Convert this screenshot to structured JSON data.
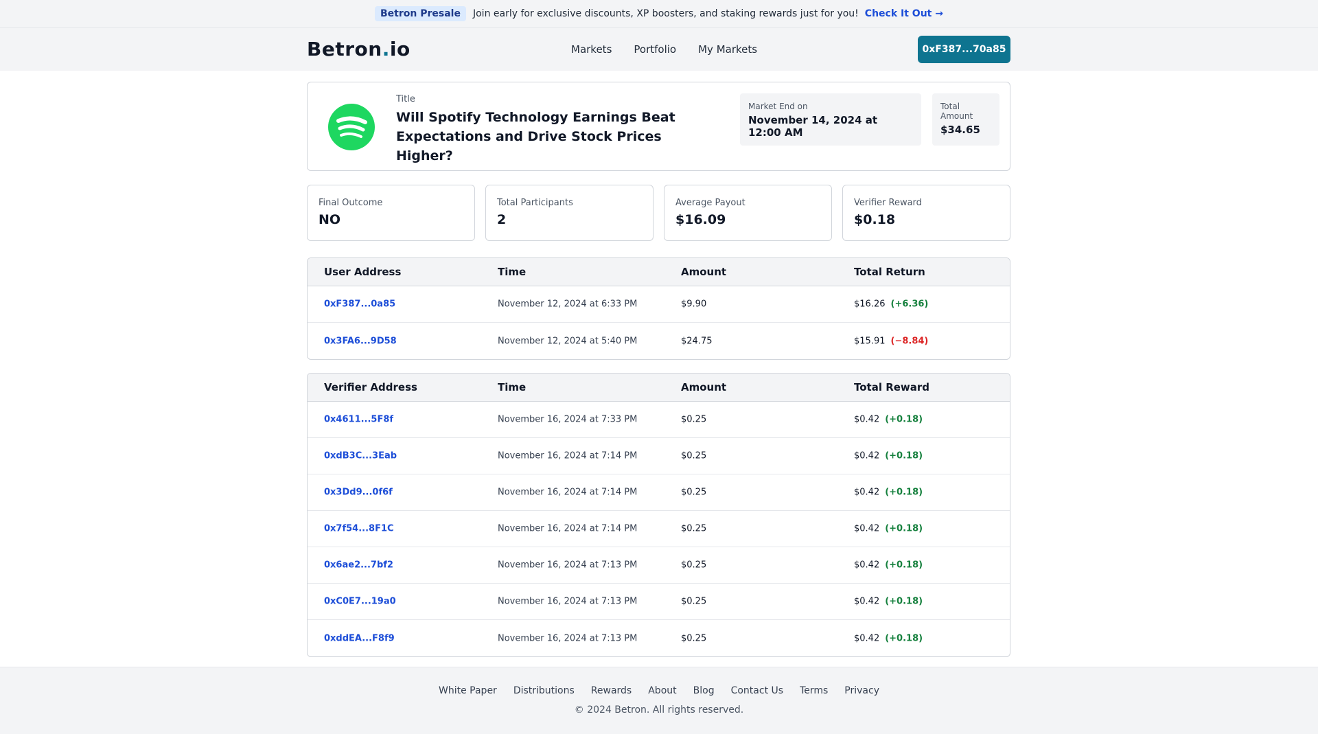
{
  "promo": {
    "tag": "Betron Presale",
    "message": "Join early for exclusive discounts, XP boosters, and staking rewards just for you!",
    "cta": "Check It Out →"
  },
  "header": {
    "logo_main": "Betron",
    "logo_dot": ".",
    "logo_suffix": "io",
    "nav": [
      "Markets",
      "Portfolio",
      "My Markets"
    ],
    "wallet": "0xF387...70a85"
  },
  "market": {
    "icon": "spotify-icon",
    "title_label": "Title",
    "title": "Will Spotify Technology Earnings Beat Expectations and Drive Stock Prices Higher?",
    "end_label": "Market End on",
    "end_value": "November 14, 2024 at 12:00 AM",
    "total_label": "Total Amount",
    "total_value": "$34.65"
  },
  "stats": [
    {
      "label": "Final Outcome",
      "value": "NO"
    },
    {
      "label": "Total Participants",
      "value": "2"
    },
    {
      "label": "Average Payout",
      "value": "$16.09"
    },
    {
      "label": "Verifier Reward",
      "value": "$0.18"
    }
  ],
  "users_table": {
    "headers": [
      "User Address",
      "Time",
      "Amount",
      "Total Return"
    ],
    "rows": [
      {
        "address": "0xF387...0a85",
        "time": "November 12, 2024 at 6:33 PM",
        "amount": "$9.90",
        "total": "$16.26",
        "delta": "(+6.36)",
        "sign": "pos"
      },
      {
        "address": "0x3FA6...9D58",
        "time": "November 12, 2024 at 5:40 PM",
        "amount": "$24.75",
        "total": "$15.91",
        "delta": "(−8.84)",
        "sign": "neg"
      }
    ]
  },
  "verifiers_table": {
    "headers": [
      "Verifier Address",
      "Time",
      "Amount",
      "Total Reward"
    ],
    "rows": [
      {
        "address": "0x4611...5F8f",
        "time": "November 16, 2024 at 7:33 PM",
        "amount": "$0.25",
        "total": "$0.42",
        "delta": "(+0.18)",
        "sign": "pos"
      },
      {
        "address": "0xdB3C...3Eab",
        "time": "November 16, 2024 at 7:14 PM",
        "amount": "$0.25",
        "total": "$0.42",
        "delta": "(+0.18)",
        "sign": "pos"
      },
      {
        "address": "0x3Dd9...0f6f",
        "time": "November 16, 2024 at 7:14 PM",
        "amount": "$0.25",
        "total": "$0.42",
        "delta": "(+0.18)",
        "sign": "pos"
      },
      {
        "address": "0x7f54...8F1C",
        "time": "November 16, 2024 at 7:14 PM",
        "amount": "$0.25",
        "total": "$0.42",
        "delta": "(+0.18)",
        "sign": "pos"
      },
      {
        "address": "0x6ae2...7bf2",
        "time": "November 16, 2024 at 7:13 PM",
        "amount": "$0.25",
        "total": "$0.42",
        "delta": "(+0.18)",
        "sign": "pos"
      },
      {
        "address": "0xC0E7...19a0",
        "time": "November 16, 2024 at 7:13 PM",
        "amount": "$0.25",
        "total": "$0.42",
        "delta": "(+0.18)",
        "sign": "pos"
      },
      {
        "address": "0xddEA...F8f9",
        "time": "November 16, 2024 at 7:13 PM",
        "amount": "$0.25",
        "total": "$0.42",
        "delta": "(+0.18)",
        "sign": "pos"
      }
    ]
  },
  "footer": {
    "links": [
      "White Paper",
      "Distributions",
      "Rewards",
      "About",
      "Blog",
      "Contact Us",
      "Terms",
      "Privacy"
    ],
    "copyright": "© 2024 Betron. All rights reserved."
  },
  "colors": {
    "accent": "#0e7490",
    "link": "#1d4ed8",
    "positive": "#15803d",
    "negative": "#dc2626",
    "spotify": "#1ed760"
  }
}
